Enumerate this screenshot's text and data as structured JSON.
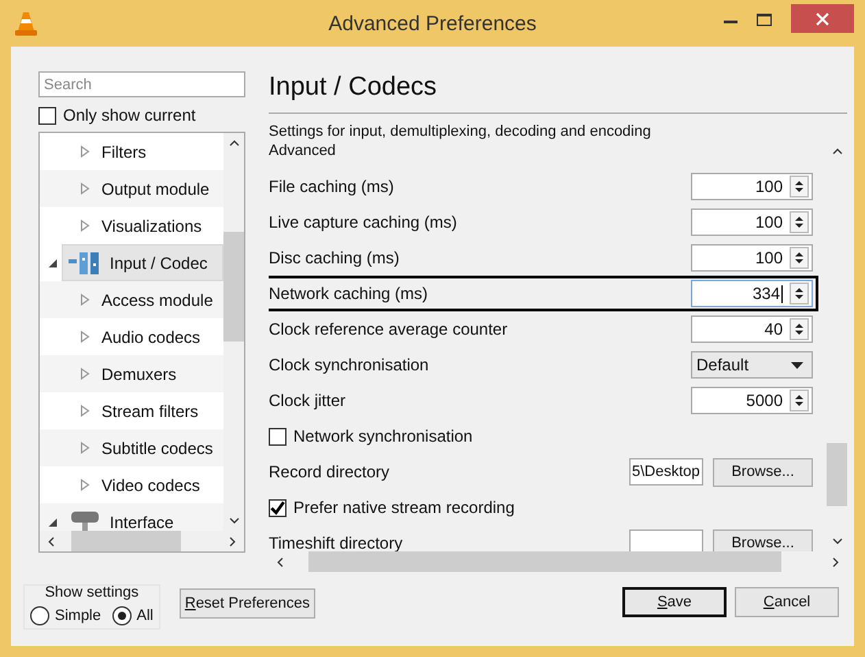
{
  "window": {
    "title": "Advanced Preferences"
  },
  "sidebar": {
    "search": {
      "placeholder": "Search"
    },
    "only_show_current": {
      "label": "Only show current",
      "checked": false
    },
    "tree_top": [
      {
        "label": "Filters",
        "expanded": false
      },
      {
        "label": "Output module",
        "expanded": false
      },
      {
        "label": "Visualizations",
        "expanded": false
      }
    ],
    "tree": [
      {
        "label": "Input / Codec",
        "kind": "codecs",
        "expanded": true,
        "selected": true,
        "children": [
          {
            "label": "Access module",
            "expanded": false
          },
          {
            "label": "Audio codecs",
            "expanded": false
          },
          {
            "label": "Demuxers",
            "expanded": false
          },
          {
            "label": "Stream filters",
            "expanded": false
          },
          {
            "label": "Subtitle codecs",
            "expanded": false
          },
          {
            "label": "Video codecs",
            "expanded": false
          }
        ]
      },
      {
        "label": "Interface",
        "kind": "interface",
        "expanded": true,
        "selected": false
      }
    ]
  },
  "panel": {
    "title": "Input / Codecs",
    "description": "Settings for input, demultiplexing, decoding and encoding",
    "group": "Advanced",
    "settings": [
      {
        "kind": "spin",
        "label": "File caching (ms)",
        "value": "100",
        "focused": false
      },
      {
        "kind": "spin",
        "label": "Live capture caching (ms)",
        "value": "100",
        "focused": false
      },
      {
        "kind": "spin",
        "label": "Disc caching (ms)",
        "value": "100",
        "focused": false
      },
      {
        "kind": "spin",
        "label": "Network caching (ms)",
        "value": "334",
        "focused": true
      },
      {
        "kind": "spin",
        "label": "Clock reference average counter",
        "value": "40",
        "focused": false
      },
      {
        "kind": "combo",
        "label": "Clock synchronisation",
        "value": "Default",
        "focused": false
      },
      {
        "kind": "spin",
        "label": "Clock jitter",
        "value": "5000",
        "focused": false
      },
      {
        "kind": "checkbox",
        "label": "Network synchronisation",
        "checked": false,
        "focused": false
      },
      {
        "kind": "dir",
        "label": "Record directory",
        "value": "5\\Desktop",
        "button": "Browse...",
        "focused": false
      },
      {
        "kind": "checkbox",
        "label": "Prefer native stream recording",
        "checked": true,
        "focused": false
      },
      {
        "kind": "dir",
        "label": "Timeshift directory",
        "button": "Browse...",
        "focused": false
      }
    ]
  },
  "show_settings": {
    "label": "Show settings",
    "options": [
      {
        "label": "Simple",
        "selected": false
      },
      {
        "label": "All",
        "selected": true
      }
    ]
  },
  "buttons": [
    {
      "label": "Reset Preferences",
      "default": false
    },
    {
      "label": "Save",
      "default": true
    },
    {
      "label": "Cancel",
      "default": false
    }
  ]
}
